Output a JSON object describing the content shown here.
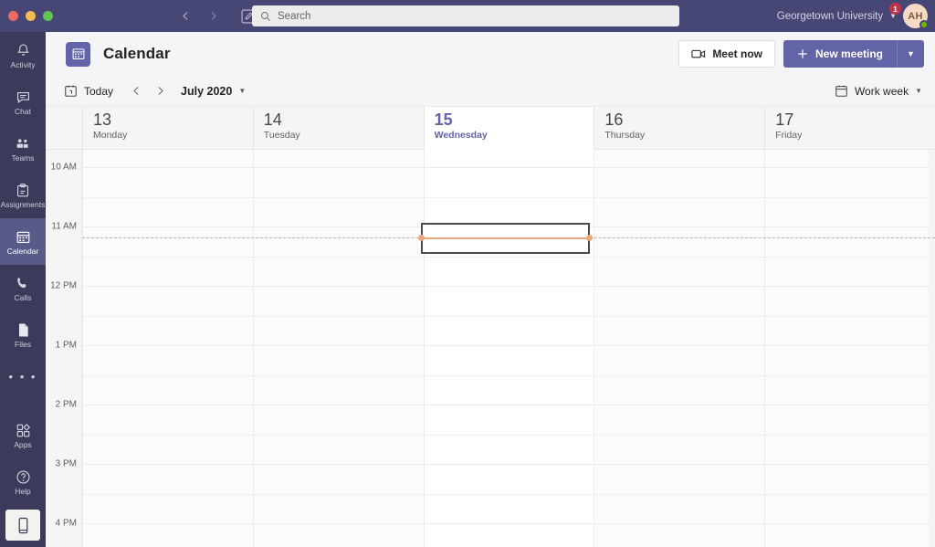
{
  "titlebar": {
    "nav_back": "back-arrow",
    "nav_forward": "forward-arrow",
    "compose": "compose-icon",
    "search": {
      "placeholder": "Search",
      "value": "",
      "icon": "search-icon"
    },
    "org": {
      "name": "Georgetown University",
      "chevron": "chevron-down-icon"
    },
    "notification_badge": "1",
    "avatar": {
      "initials": "AH",
      "presence": "available"
    }
  },
  "rail": {
    "items": [
      {
        "label": "Activity",
        "icon": "bell-icon",
        "active": false
      },
      {
        "label": "Chat",
        "icon": "chat-icon",
        "active": false
      },
      {
        "label": "Teams",
        "icon": "teams-icon",
        "active": false
      },
      {
        "label": "Assignments",
        "icon": "assignments-icon",
        "active": false
      },
      {
        "label": "Calendar",
        "icon": "calendar-icon",
        "active": true
      },
      {
        "label": "Calls",
        "icon": "phone-icon",
        "active": false
      },
      {
        "label": "Files",
        "icon": "files-icon",
        "active": false
      }
    ],
    "more": "• • •",
    "bottom_items": [
      {
        "label": "Apps",
        "icon": "apps-icon"
      },
      {
        "label": "Help",
        "icon": "help-icon"
      }
    ],
    "download_app": "mobile-device-icon"
  },
  "apphead": {
    "icon": "calendar-app-icon",
    "title": "Calendar",
    "meet_now": {
      "label": "Meet now",
      "icon": "camera-icon"
    },
    "new_meeting": {
      "label": "New meeting",
      "icon": "plus-icon",
      "chevron": "chevron-down-icon"
    }
  },
  "calbar": {
    "today": {
      "label": "Today",
      "icon": "today-icon"
    },
    "prev": "chevron-left-icon",
    "next": "chevron-right-icon",
    "period": "July 2020",
    "period_chevron": "chevron-down-icon",
    "view": {
      "label": "Work week",
      "icon": "calendar-view-icon",
      "chevron": "chevron-down-icon"
    }
  },
  "calendar": {
    "days": [
      {
        "num": "13",
        "name": "Monday",
        "today": false
      },
      {
        "num": "14",
        "name": "Tuesday",
        "today": false
      },
      {
        "num": "15",
        "name": "Wednesday",
        "today": true
      },
      {
        "num": "16",
        "name": "Thursday",
        "today": false
      },
      {
        "num": "17",
        "name": "Friday",
        "today": false
      }
    ],
    "time_labels": [
      "10 AM",
      "11 AM",
      "12 PM",
      "1 PM",
      "2 PM",
      "3 PM",
      "4 PM"
    ],
    "current_time_row": "11 AM",
    "selection": {
      "day": "Wednesday",
      "start": "11:00 AM",
      "end": "11:30 AM"
    },
    "events": []
  },
  "colors": {
    "brand_purple": "#6264a7",
    "titlebar": "#464775",
    "rail": "#3b3a5a",
    "rail_active": "#585a87",
    "now_line": "#e8a87c",
    "badge_red": "#c4314b",
    "presence_green": "#6bb700"
  }
}
